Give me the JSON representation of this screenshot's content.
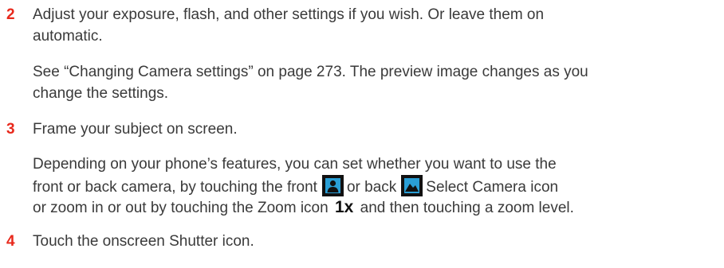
{
  "steps": [
    {
      "number": "2",
      "text_line1": "Adjust your exposure, flash, and other settings if you wish. Or leave them on",
      "text_line2": "automatic.",
      "note_line1": "See “Changing Camera settings” on page 273. The preview image changes as you",
      "note_line2": "change the settings."
    },
    {
      "number": "3",
      "text_line1": "Frame your subject on screen.",
      "note_line1": "Depending on your phone’s features, you can set whether you want to use the",
      "note_line2_a": "front or back camera, by touching the front",
      "note_line2_b": "or back",
      "note_line2_c": "Select Camera icon",
      "note_line3_a": "or zoom in or out by touching the Zoom icon",
      "zoom_icon_label": "1x",
      "note_line3_b": "and then touching a zoom level."
    },
    {
      "number": "4",
      "text_line1": "Touch the onscreen Shutter icon."
    }
  ],
  "colors": {
    "step_number": "#e8291c",
    "body_text": "#3a3a3a",
    "icon_background": "#111111",
    "icon_glyph": "#2a9fd6"
  },
  "icons": {
    "front_camera": "front-camera-icon",
    "back_camera": "back-camera-icon"
  }
}
